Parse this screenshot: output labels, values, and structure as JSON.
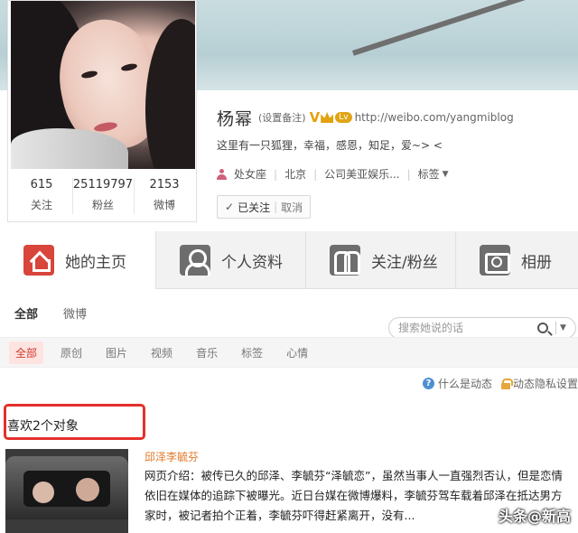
{
  "profile": {
    "name": "杨幂",
    "remark_link": "(设置备注)",
    "verified_badge": "V",
    "level_badge": "Lv",
    "blog_url": "http://weibo.com/yangmiblog",
    "bio": "这里有一只狐狸，幸福，感恩，知足，爱~> <",
    "tags": {
      "zodiac": "处女座",
      "location": "北京",
      "company": "公司美亚娱乐...",
      "tag_label": "标签"
    },
    "follow_state": "已关注",
    "cancel_label": "取消",
    "stats": [
      {
        "value": "615",
        "label": "关注"
      },
      {
        "value": "25119797",
        "label": "粉丝"
      },
      {
        "value": "2153",
        "label": "微博"
      }
    ]
  },
  "tabs": [
    {
      "label": "她的主页",
      "icon": "home-icon"
    },
    {
      "label": "个人资料",
      "icon": "profile-icon"
    },
    {
      "label": "关注/粉丝",
      "icon": "follow-icon"
    },
    {
      "label": "相册",
      "icon": "camera-icon"
    }
  ],
  "subnav": {
    "all": "全部",
    "weibo": "微博"
  },
  "search": {
    "placeholder": "搜索她说的话"
  },
  "filters": [
    "全部",
    "原创",
    "图片",
    "视频",
    "音乐",
    "标签",
    "心情"
  ],
  "help": {
    "what_is_feed": "什么是动态",
    "privacy": "动态隐私设置"
  },
  "feed_item": {
    "title": "喜欢2个对象",
    "author": "邱泽李毓芬",
    "text": "网页介绍：被传已久的邱泽、李毓芬“泽毓恋”，虽然当事人一直强烈否认，但是恋情依旧在媒体的追踪下被曝光。近日台媒在微博爆料，李毓芬驾车载着邱泽在抵达男方家时，被记者拍个正着，李毓芬吓得赶紧离开，没有..."
  },
  "watermark": "头条@新高"
}
